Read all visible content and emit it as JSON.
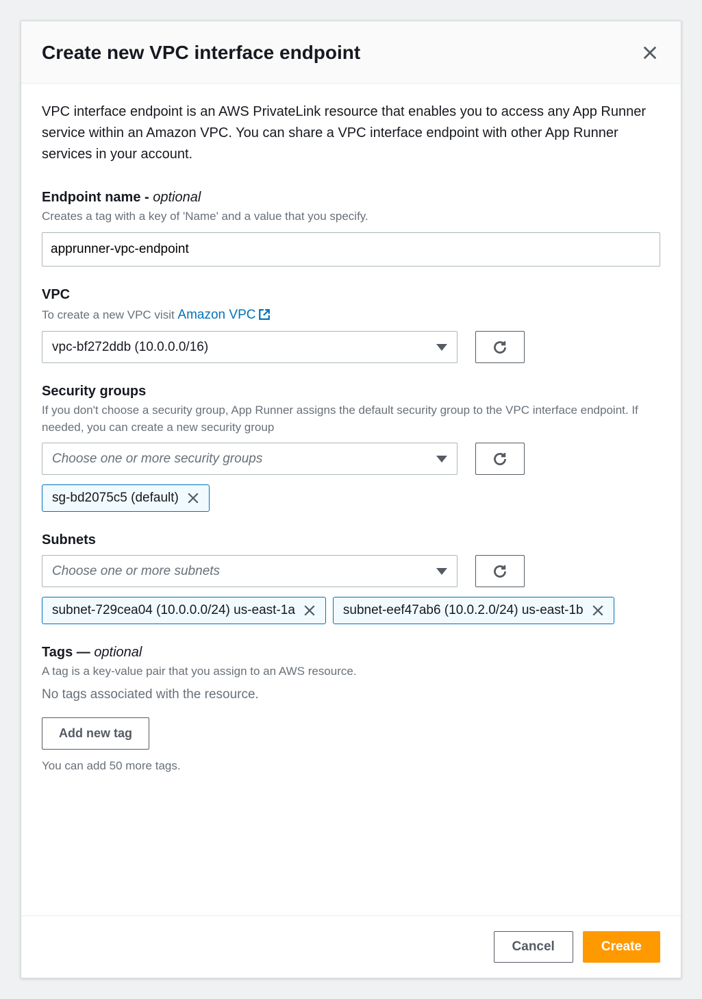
{
  "modal": {
    "title": "Create new VPC interface endpoint",
    "intro": "VPC interface endpoint is an AWS PrivateLink resource that enables you to access any App Runner service within an Amazon VPC. You can share a VPC interface endpoint with other App Runner services in your account."
  },
  "endpoint_name": {
    "label": "Endpoint name - ",
    "optional": "optional",
    "description": "Creates a tag with a key of 'Name' and a value that you specify.",
    "value": "apprunner-vpc-endpoint"
  },
  "vpc": {
    "label": "VPC",
    "desc_prefix": "To create a new VPC visit ",
    "link_text": "Amazon VPC",
    "selected": "vpc-bf272ddb (10.0.0.0/16)"
  },
  "security_groups": {
    "label": "Security groups",
    "description": "If you don't choose a security group, App Runner assigns the default security group to the VPC interface endpoint. If needed, you can create a new security group",
    "placeholder": "Choose one or more security groups",
    "selected": [
      "sg-bd2075c5 (default)"
    ]
  },
  "subnets": {
    "label": "Subnets",
    "placeholder": "Choose one or more subnets",
    "selected": [
      "subnet-729cea04 (10.0.0.0/24) us-east-1a",
      "subnet-eef47ab6 (10.0.2.0/24) us-east-1b"
    ]
  },
  "tags": {
    "label_prefix": "Tags — ",
    "optional": "optional",
    "description": "A tag is a key-value pair that you assign to an AWS resource.",
    "none_text": "No tags associated with the resource.",
    "add_button": "Add new tag",
    "limit_text": "You can add 50 more tags."
  },
  "footer": {
    "cancel": "Cancel",
    "create": "Create"
  }
}
